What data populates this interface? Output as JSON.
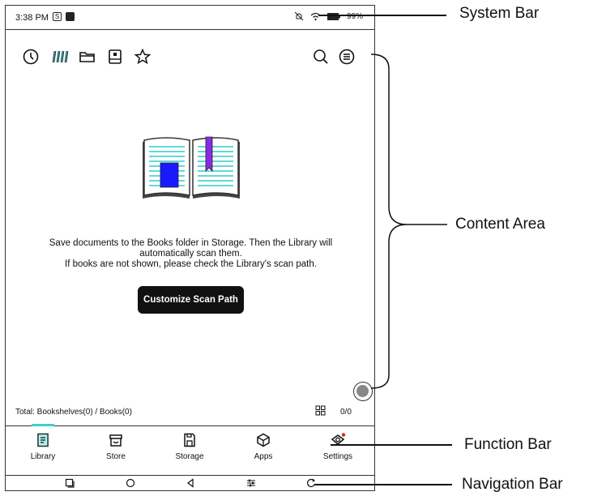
{
  "status_bar": {
    "time": "3:38 PM",
    "box_icon_1": "S",
    "battery": "99%"
  },
  "toolbar": {
    "icons": [
      "clock-icon",
      "bookshelf-icon",
      "folder-icon",
      "storage-icon",
      "star-icon",
      "search-icon",
      "menu-icon"
    ]
  },
  "content": {
    "message_line1": "Save documents to the Books folder in Storage. Then the Library will",
    "message_line2": "automatically scan them.",
    "message_line3": "If books are not shown, please check the Library's scan path.",
    "scan_button": "Customize Scan Path",
    "total": "Total: Bookshelves(0) / Books(0)",
    "page_count": "0/0"
  },
  "function_bar": {
    "items": [
      {
        "label": "Library",
        "icon": "library-icon"
      },
      {
        "label": "Store",
        "icon": "store-icon"
      },
      {
        "label": "Storage",
        "icon": "storage-icon"
      },
      {
        "label": "Apps",
        "icon": "apps-icon"
      },
      {
        "label": "Settings",
        "icon": "settings-icon"
      }
    ],
    "indicator_color": "#44cccc",
    "notification_color": "#e02020"
  },
  "nav_bar": {
    "icons": [
      "recent-apps-icon",
      "home-icon",
      "back-icon",
      "adjust-icon",
      "refresh-icon"
    ]
  },
  "callouts": {
    "system_bar": "System Bar",
    "content_area": "Content Area",
    "function_bar": "Function Bar",
    "navigation_bar": "Navigation Bar"
  },
  "illustration_colors": {
    "lines": "#33cccc",
    "block": "#1a1aff",
    "bookmark": "#8a2be2"
  }
}
